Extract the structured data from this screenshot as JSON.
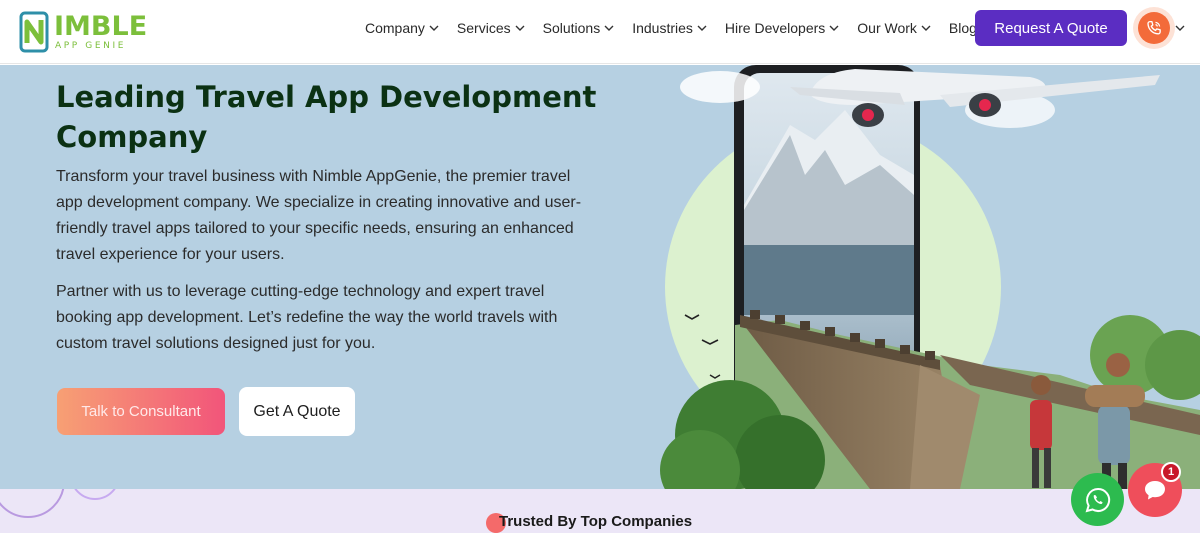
{
  "logo": {
    "word": "IMBLE",
    "sub": "APP GENIE",
    "color": "#7cbf3b",
    "icon": "logo-n-icon"
  },
  "nav": {
    "items": [
      {
        "label": "Company",
        "has_dropdown": true
      },
      {
        "label": "Services",
        "has_dropdown": true
      },
      {
        "label": "Solutions",
        "has_dropdown": true
      },
      {
        "label": "Industries",
        "has_dropdown": true
      },
      {
        "label": "Hire Developers",
        "has_dropdown": true
      },
      {
        "label": "Our Work",
        "has_dropdown": true
      },
      {
        "label": "Blog",
        "has_dropdown": false
      }
    ],
    "quote_button": "Request A Quote",
    "phone_icon": "phone-icon"
  },
  "hero": {
    "title": "Leading Travel App Development Company",
    "paragraph1": "Transform your travel business with Nimble AppGenie, the premier travel app development company. We specialize in creating innovative and user-friendly travel apps tailored to your specific needs, ensuring an enhanced travel experience for your users.",
    "paragraph2": "Partner with us to leverage cutting-edge technology and expert travel booking app development. Let’s redefine the way the world travels with custom travel solutions designed just for you.",
    "consult_button": "Talk to Consultant",
    "quote_button": "Get A Quote",
    "background_color": "#b6d0e2",
    "title_color": "#0b3113"
  },
  "trusted": {
    "title": "Trusted By Top Companies"
  },
  "floating": {
    "whatsapp_icon": "whatsapp-icon",
    "chat_icon": "chat-icon",
    "chat_badge": "1"
  },
  "colors": {
    "accent": "#5b2dc2",
    "consult_start": "#f7a074",
    "consult_end": "#f2557a",
    "whatsapp": "#2dbb4f",
    "chat": "#ef4e5b"
  }
}
